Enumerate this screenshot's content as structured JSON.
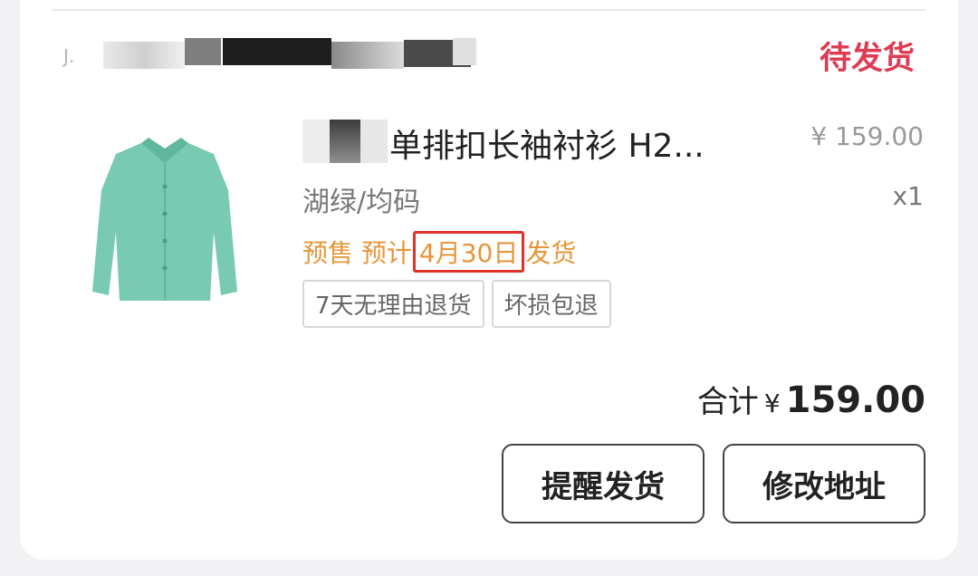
{
  "store": {
    "name_prefix": "J."
  },
  "order": {
    "status": "待发货"
  },
  "product": {
    "title": "单排扣长袖衬衫 H2...",
    "price": "¥ 159.00",
    "variant": "湖绿/均码",
    "quantity": "x1",
    "presale_prefix": "预售 预计",
    "presale_date": "4月30日",
    "presale_suffix": "发货",
    "tags": [
      "7天无理由退货",
      "坏损包退"
    ]
  },
  "summary": {
    "label": "合计",
    "currency": "¥",
    "amount": "159.00"
  },
  "actions": {
    "remind_label": "提醒发货",
    "edit_address_label": "修改地址"
  },
  "colors": {
    "status": "#dd3c54",
    "presale": "#e6963a",
    "highlight_box": "#e0322a",
    "shirt": "#78cbb2"
  }
}
